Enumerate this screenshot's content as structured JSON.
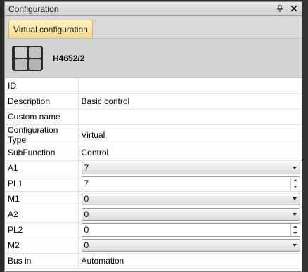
{
  "window": {
    "title": "Configuration"
  },
  "tabs": [
    {
      "label": "Virtual configuration"
    }
  ],
  "device": {
    "name": "H4652/2",
    "icon": "keypad-device-icon"
  },
  "properties": [
    {
      "key": "ID",
      "value": "",
      "kind": "text"
    },
    {
      "key": "Description",
      "value": "Basic control",
      "kind": "text"
    },
    {
      "key": "Custom name",
      "value": "",
      "kind": "text"
    },
    {
      "key": "Configuration Type",
      "value": "Virtual",
      "kind": "text"
    },
    {
      "key": "SubFunction",
      "value": "Control",
      "kind": "text"
    },
    {
      "key": "A1",
      "value": "7",
      "kind": "combo"
    },
    {
      "key": "PL1",
      "value": "7",
      "kind": "spin"
    },
    {
      "key": "M1",
      "value": "0",
      "kind": "combo"
    },
    {
      "key": "A2",
      "value": "0",
      "kind": "combo"
    },
    {
      "key": "PL2",
      "value": "0",
      "kind": "spin"
    },
    {
      "key": "M2",
      "value": "0",
      "kind": "combo"
    },
    {
      "key": "Bus in",
      "value": "Automation",
      "kind": "text"
    }
  ],
  "colors": {
    "tab_active": "#f6d98a",
    "header_bg": "#d4d4d4"
  }
}
